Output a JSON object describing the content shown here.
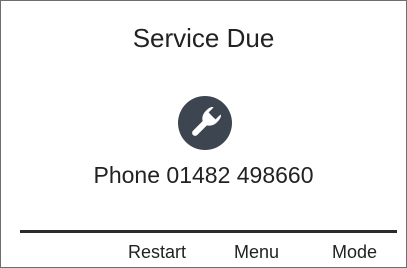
{
  "screen": {
    "title": "Service Due",
    "icon": "wrench-icon",
    "phone_text": "Phone 01482 498660",
    "colors": {
      "icon_background": "#3d4650",
      "icon_foreground": "#ffffff",
      "text": "#222222",
      "divider": "#2b2b2b"
    }
  },
  "softkeys": {
    "restart": "Restart",
    "menu": "Menu",
    "mode": "Mode"
  }
}
